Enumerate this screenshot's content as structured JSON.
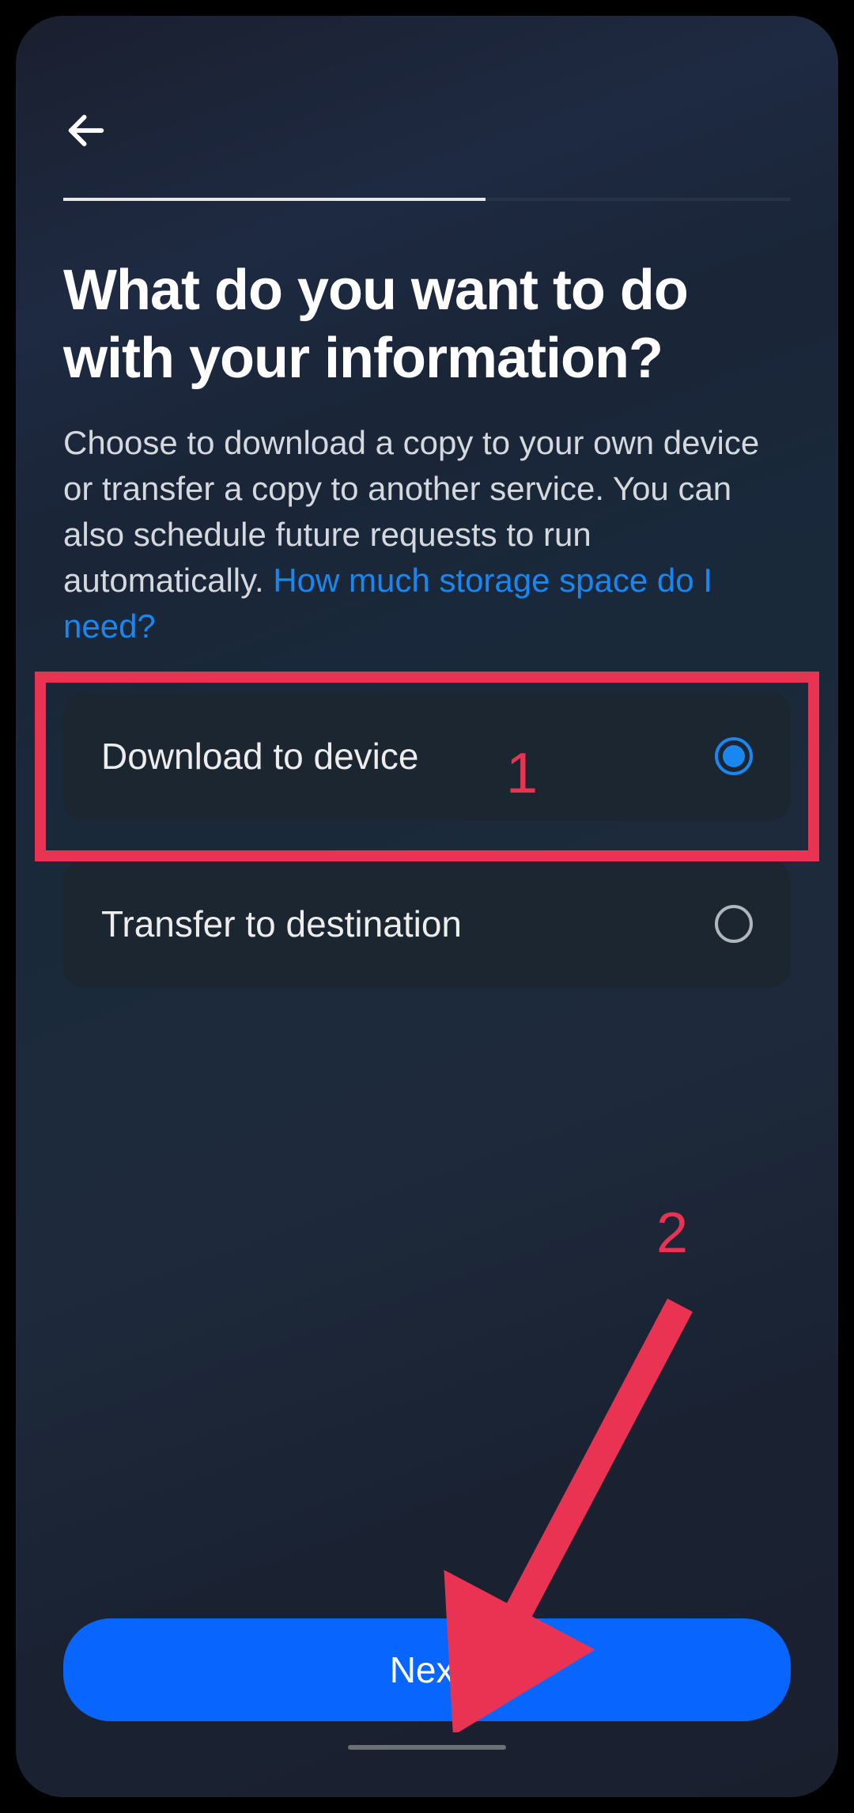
{
  "header": {
    "back_aria": "Back"
  },
  "progress": {
    "percent": 58
  },
  "title": "What do you want to do with your information?",
  "description": {
    "text": "Choose to download a copy to your own device or transfer a copy to another service. You can also schedule future requests to run automatically. ",
    "link_text": "How much storage space do I need?"
  },
  "options": [
    {
      "label": "Download to device",
      "selected": true
    },
    {
      "label": "Transfer to destination",
      "selected": false
    }
  ],
  "footer": {
    "next_label": "Next"
  },
  "annotations": {
    "num1": "1",
    "num2": "2",
    "highlight1_color": "#ea3352",
    "arrow_color": "#ea3352"
  }
}
